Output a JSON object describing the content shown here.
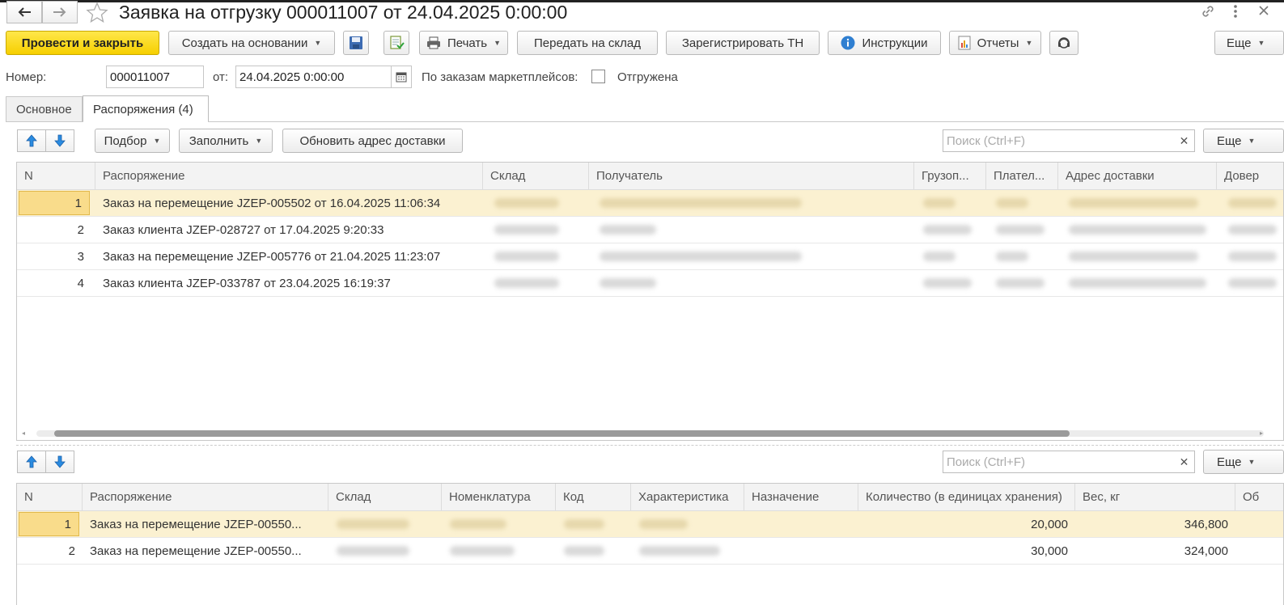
{
  "window": {
    "title": "Заявка на отгрузку 000011007 от 24.04.2025 0:00:00"
  },
  "toolbar": {
    "post_close": "Провести и закрыть",
    "create_based": "Создать на основании",
    "print": "Печать",
    "transfer": "Передать на склад",
    "register_tn": "Зарегистрировать ТН",
    "instructions": "Инструкции",
    "reports": "Отчеты",
    "more": "Еще"
  },
  "form": {
    "number_label": "Номер:",
    "number_value": "000011007",
    "date_label": "от:",
    "date_value": "24.04.2025  0:00:00",
    "marketplace_label": "По заказам маркетплейсов:",
    "shipped_label": "Отгружена"
  },
  "tabs": [
    {
      "label": "Основное"
    },
    {
      "label": "Распоряжения (4)"
    }
  ],
  "top_panel": {
    "selection_btn": "Подбор",
    "fill_btn": "Заполнить",
    "update_address_btn": "Обновить адрес доставки",
    "search_placeholder": "Поиск (Ctrl+F)",
    "more_btn": "Еще",
    "columns": [
      "N",
      "Распоряжение",
      "Склад",
      "Получатель",
      "Грузоп...",
      "Плател...",
      "Адрес доставки",
      "Довер"
    ],
    "rows": [
      {
        "n": "1",
        "order": "Заказ на перемещение JZEP-005502 от 16.04.2025 11:06:34"
      },
      {
        "n": "2",
        "order": "Заказ клиента JZEP-028727 от 17.04.2025 9:20:33"
      },
      {
        "n": "3",
        "order": "Заказ на перемещение JZEP-005776 от 21.04.2025 11:23:07"
      },
      {
        "n": "4",
        "order": "Заказ клиента JZEP-033787 от 23.04.2025 16:19:37"
      }
    ]
  },
  "bottom_panel": {
    "search_placeholder": "Поиск (Ctrl+F)",
    "more_btn": "Еще",
    "columns": [
      "N",
      "Распоряжение",
      "Склад",
      "Номенклатура",
      "Код",
      "Характеристика",
      "Назначение",
      "Количество (в единицах хранения)",
      "Вес, кг",
      "Об"
    ],
    "rows": [
      {
        "n": "1",
        "order": "Заказ на перемещение JZEP-00550...",
        "qty": "20,000",
        "weight": "346,800"
      },
      {
        "n": "2",
        "order": "Заказ на перемещение JZEP-00550...",
        "qty": "30,000",
        "weight": "324,000"
      }
    ]
  }
}
